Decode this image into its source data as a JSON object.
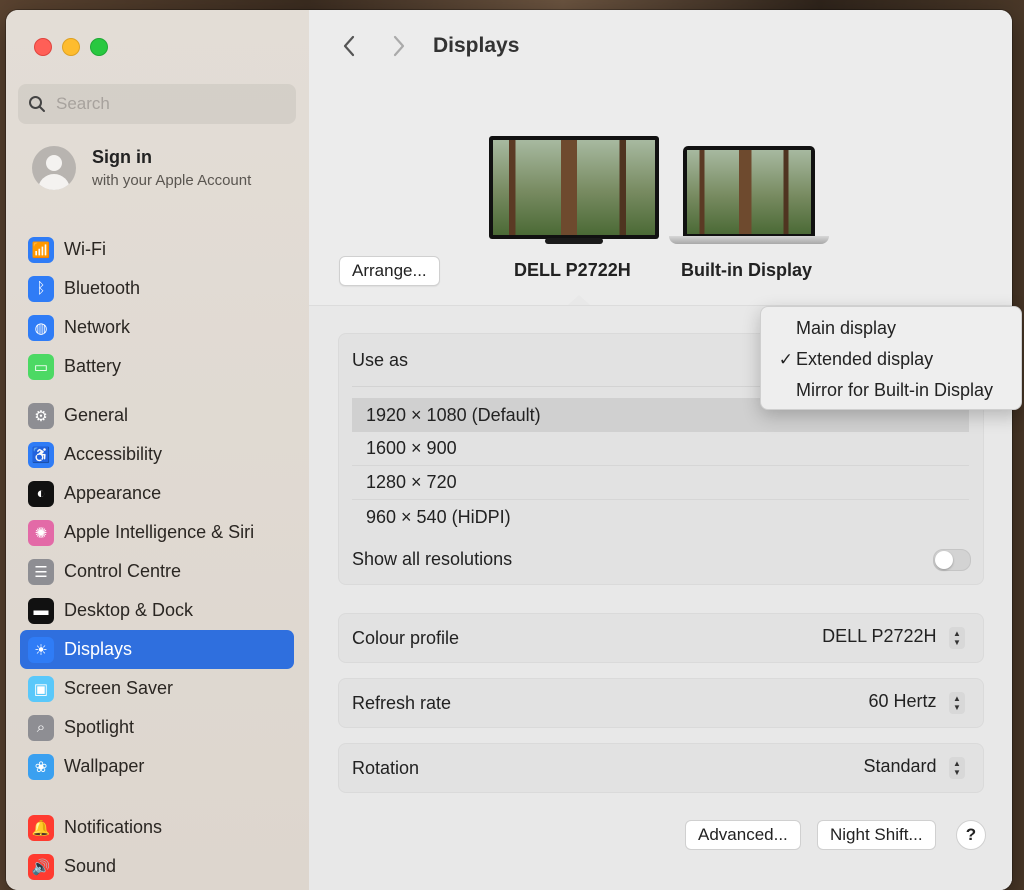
{
  "sidebar": {
    "search_placeholder": "Search",
    "account": {
      "title": "Sign in",
      "subtitle": "with your Apple Account"
    },
    "groups": [
      [
        {
          "label": "Wi-Fi",
          "icon": "wifi-icon",
          "color": "#2f7cf6"
        },
        {
          "label": "Bluetooth",
          "icon": "bluetooth-icon",
          "color": "#2f7cf6"
        },
        {
          "label": "Network",
          "icon": "globe-icon",
          "color": "#2f7cf6"
        },
        {
          "label": "Battery",
          "icon": "battery-icon",
          "color": "#4cd964"
        }
      ],
      [
        {
          "label": "General",
          "icon": "gear-icon",
          "color": "#8e8e93"
        },
        {
          "label": "Accessibility",
          "icon": "accessibility-icon",
          "color": "#2f7cf6"
        },
        {
          "label": "Appearance",
          "icon": "appearance-icon",
          "color": "#111111"
        },
        {
          "label": "Apple Intelligence & Siri",
          "icon": "siri-icon",
          "color": "#e36aa7"
        },
        {
          "label": "Control Centre",
          "icon": "control-centre-icon",
          "color": "#8e8e93"
        },
        {
          "label": "Desktop & Dock",
          "icon": "dock-icon",
          "color": "#111111"
        },
        {
          "label": "Displays",
          "icon": "sun-icon",
          "color": "#2f7cf6",
          "active": true
        },
        {
          "label": "Screen Saver",
          "icon": "screensaver-icon",
          "color": "#5ac8fa"
        },
        {
          "label": "Spotlight",
          "icon": "magnifier-icon",
          "color": "#8e8e93"
        },
        {
          "label": "Wallpaper",
          "icon": "flower-icon",
          "color": "#3aa0f0"
        }
      ],
      [
        {
          "label": "Notifications",
          "icon": "bell-icon",
          "color": "#ff3b30"
        },
        {
          "label": "Sound",
          "icon": "speaker-icon",
          "color": "#ff3b30"
        }
      ]
    ]
  },
  "toolbar": {
    "title": "Displays"
  },
  "displays": {
    "arrange_label": "Arrange...",
    "external_name": "DELL P2722H",
    "builtin_name": "Built-in Display"
  },
  "use_as": {
    "label": "Use as",
    "resolutions": [
      "1920 × 1080 (Default)",
      "1600 × 900",
      "1280 × 720",
      "960 × 540 (HiDPI)"
    ],
    "selected_resolution": 0,
    "show_all_label": "Show all resolutions",
    "show_all_enabled": false
  },
  "settings": {
    "colour_profile": {
      "label": "Colour profile",
      "value": "DELL P2722H"
    },
    "refresh_rate": {
      "label": "Refresh rate",
      "value": "60 Hertz"
    },
    "rotation": {
      "label": "Rotation",
      "value": "Standard"
    }
  },
  "buttons": {
    "advanced": "Advanced...",
    "night_shift": "Night Shift...",
    "help": "?"
  },
  "menu": {
    "items": [
      {
        "label": "Main display",
        "checked": false
      },
      {
        "label": "Extended display",
        "checked": true
      },
      {
        "label": "Mirror for Built-in Display",
        "checked": false
      }
    ],
    "check_glyph": "✓"
  }
}
